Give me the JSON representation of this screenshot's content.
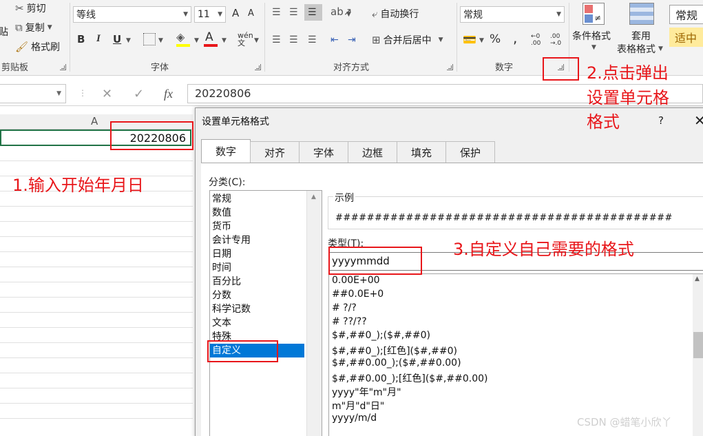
{
  "ribbon": {
    "clipboard": {
      "paste_label": "粘贴",
      "cut_label": "剪切",
      "copy_label": "复制",
      "format_painter_label": "格式刷",
      "group_label": "剪贴板"
    },
    "font": {
      "font_name": "等线",
      "font_size": "11",
      "bold": "B",
      "italic": "I",
      "underline": "U",
      "group_label": "字体",
      "grow": "A",
      "shrink": "A",
      "phonetic": "wén文"
    },
    "alignment": {
      "wrap_text_label": "自动换行",
      "merge_center_label": "合并后居中",
      "group_label": "对齐方式"
    },
    "number": {
      "format_value": "常规",
      "percent": "%",
      "comma": ",",
      "group_label": "数字"
    },
    "styles": {
      "conditional_format_label": "条件格式",
      "table_format_label_1": "套用",
      "table_format_label_2": "表格格式",
      "cell_style_normal": "常规",
      "cell_style_neutral": "适中"
    }
  },
  "formula_bar": {
    "cancel_symbol": "✕",
    "enter_symbol": "✓",
    "fx_symbol": "fx",
    "value": "20220806"
  },
  "sheet": {
    "column_a": "A",
    "cell_value": "20220806"
  },
  "dialog": {
    "title": "设置单元格格式",
    "help": "?",
    "close": "✕",
    "tabs": [
      {
        "label": "数字"
      },
      {
        "label": "对齐"
      },
      {
        "label": "字体"
      },
      {
        "label": "边框"
      },
      {
        "label": "填充"
      },
      {
        "label": "保护"
      }
    ],
    "category_label": "分类(C):",
    "categories": [
      "常规",
      "数值",
      "货币",
      "会计专用",
      "日期",
      "时间",
      "百分比",
      "分数",
      "科学记数",
      "文本",
      "特殊",
      "自定义"
    ],
    "selected_category": "自定义",
    "sample_label": "示例",
    "sample_value": "###########################################",
    "type_label": "类型(T):",
    "type_value": "yyyymmdd",
    "type_list": [
      "0.00E+00",
      "##0.0E+0",
      "# ?/?",
      "# ??/??",
      "$#,##0_);($#,##0)",
      "$#,##0_);[红色]($#,##0)",
      "$#,##0.00_);($#,##0.00)",
      "$#,##0.00_);[红色]($#,##0.00)",
      "yyyy\"年\"m\"月\"",
      "m\"月\"d\"日\"",
      "yyyy/m/d"
    ]
  },
  "annotations": {
    "step1": "1.输入开始年月日",
    "step2_line1": "2.点击弹出",
    "step2_line2": "设置单元格",
    "step2_line3": "格式",
    "step3": "3.自定义自己需要的格式",
    "color": "#e8161a"
  },
  "watermark": "CSDN @蜡笔小欣丫"
}
